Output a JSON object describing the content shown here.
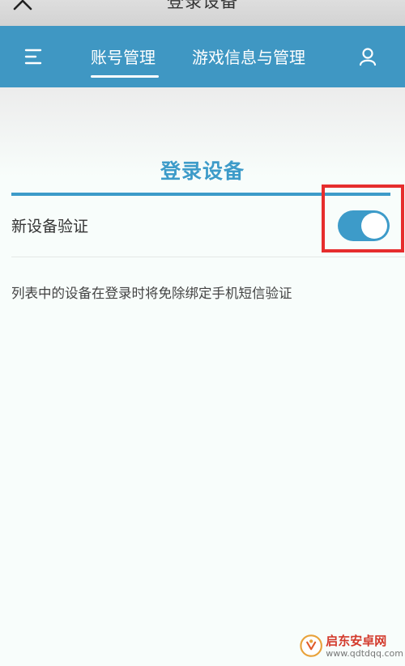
{
  "topbar": {
    "title": "登录设备",
    "back_icon": "chevron-left-icon"
  },
  "navbar": {
    "menu_icon": "menu-icon",
    "tabs": [
      {
        "label": "账号管理",
        "active": true
      },
      {
        "label": "游戏信息与管理",
        "active": false
      }
    ],
    "user_icon": "user-icon"
  },
  "section": {
    "title": "登录设备"
  },
  "new_device_verify": {
    "label": "新设备验证",
    "enabled": true
  },
  "description": "列表中的设备在登录时将免除绑定手机短信验证",
  "watermark": {
    "name": "启东安卓网",
    "url": "www.qdtdqq.com"
  },
  "colors": {
    "accent": "#3d9bc9",
    "navbar": "#3f97c3",
    "highlight": "#e62d2d"
  }
}
